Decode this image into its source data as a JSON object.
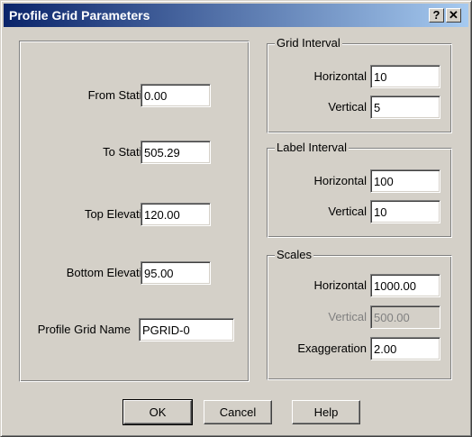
{
  "window": {
    "title": "Profile Grid Parameters",
    "help_glyph": "?",
    "close_glyph": "✕"
  },
  "left": {
    "from_station": {
      "label": "From Station",
      "value": "0.00"
    },
    "to_station": {
      "label": "To Station",
      "value": "505.29"
    },
    "top_elevation": {
      "label": "Top Elevation",
      "value": "120.00"
    },
    "bottom_elevation": {
      "label": "Bottom Elevation",
      "value": "95.00"
    },
    "grid_name": {
      "label": "Profile Grid Name",
      "value": "PGRID-0"
    }
  },
  "grid_interval": {
    "legend": "Grid Interval",
    "horizontal": {
      "label": "Horizontal",
      "value": "10"
    },
    "vertical": {
      "label": "Vertical",
      "value": "5"
    }
  },
  "label_interval": {
    "legend": "Label Interval",
    "horizontal": {
      "label": "Horizontal",
      "value": "100"
    },
    "vertical": {
      "label": "Vertical",
      "value": "10"
    }
  },
  "scales": {
    "legend": "Scales",
    "horizontal": {
      "label": "Horizontal",
      "value": "1000.00"
    },
    "vertical": {
      "label": "Vertical",
      "value": "500.00",
      "disabled": true
    },
    "exaggeration": {
      "label": "Exaggeration",
      "value": "2.00"
    }
  },
  "buttons": {
    "ok": "OK",
    "cancel": "Cancel",
    "help": "Help"
  },
  "colors": {
    "title_start": "#0a246a",
    "title_end": "#a6caf0",
    "face": "#d4d0c8"
  }
}
